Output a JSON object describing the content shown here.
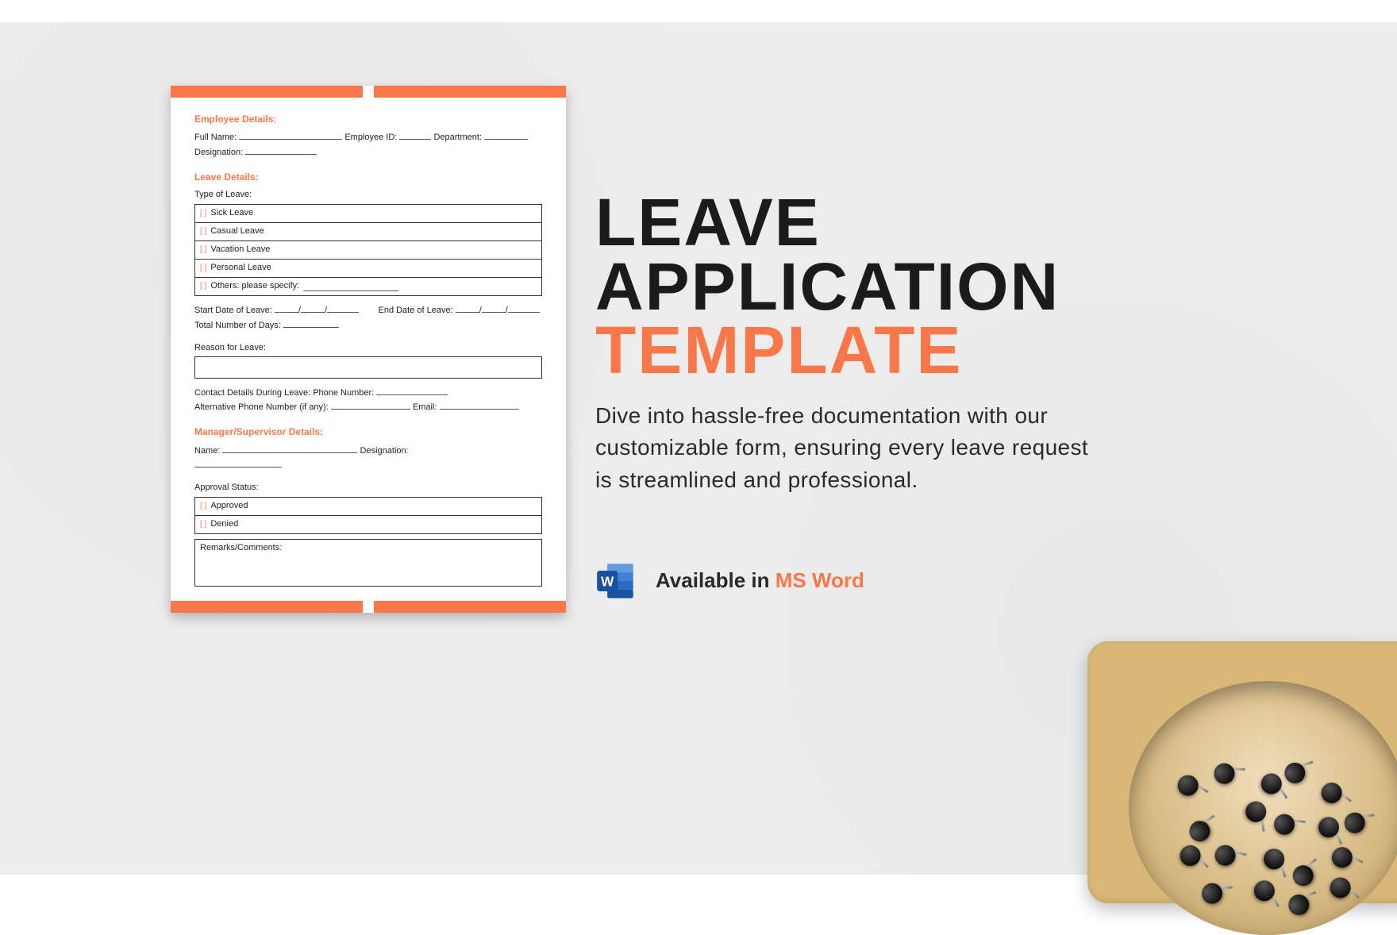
{
  "doc": {
    "sections": {
      "employee": {
        "heading": "Employee Details:",
        "fullNameLabel": "Full Name:",
        "employeeIdLabel": "Employee ID:",
        "departmentLabel": "Department:",
        "designationLabel": "Designation:"
      },
      "leave": {
        "heading": "Leave Details:",
        "typeLabel": "Type of Leave:",
        "options": [
          "Sick Leave",
          "Casual Leave",
          "Vacation Leave",
          "Personal Leave",
          "Others: please specify:"
        ],
        "startLabel": "Start Date of Leave:",
        "endLabel": "End Date of Leave:",
        "totalDaysLabel": "Total Number of Days:",
        "reasonLabel": "Reason for Leave:",
        "contactLabel": "Contact Details During Leave: Phone Number:",
        "altPhoneLabel": "Alternative Phone Number (if any):",
        "emailLabel": "Email:"
      },
      "manager": {
        "heading": "Manager/Supervisor Details:",
        "nameLabel": "Name:",
        "designationLabel": "Designation:",
        "approvalLabel": "Approval Status:",
        "options": [
          "Approved",
          "Denied"
        ],
        "remarksLabel": "Remarks/Comments:"
      }
    }
  },
  "right": {
    "titleLine1": "LEAVE",
    "titleLine2": "APPLICATION",
    "titleLine3": "TEMPLATE",
    "description": "Dive into hassle-free documentation with our customizable form, ensuring every leave request is streamlined and professional.",
    "availablePrefix": "Available in ",
    "availableAccent": "MS Word"
  },
  "colors": {
    "accent": "#fa7749"
  },
  "checkboxGlyph": "[ ]"
}
